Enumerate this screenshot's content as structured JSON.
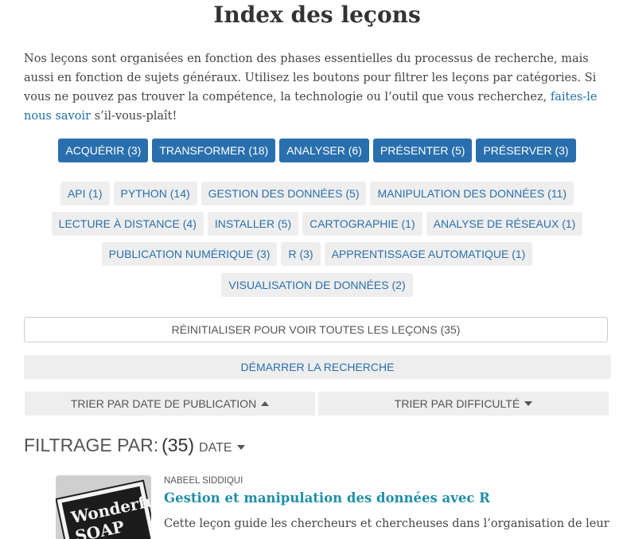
{
  "page": {
    "title": "Index des leçons",
    "intro_text": "Nos leçons sont organisées en fonction des phases essentielles du processus de recherche, mais aussi en fonction de sujets généraux. Utilisez les boutons pour filtrer les leçons par catégories. Si vous ne pouvez pas trouver la compétence, la technologie ou l’outil que vous recherchez, ",
    "intro_link": "faites-le nous savoir",
    "intro_end": " s’il-vous-plaît!"
  },
  "phases": [
    {
      "label": "ACQUÉRIR (3)"
    },
    {
      "label": "TRANSFORMER (18)"
    },
    {
      "label": "ANALYSER (6)"
    },
    {
      "label": "PRÉSENTER (5)"
    },
    {
      "label": "PRÉSERVER (3)"
    }
  ],
  "topics": {
    "row1": [
      {
        "label": "API (1)"
      },
      {
        "label": "PYTHON (14)"
      },
      {
        "label": "GESTION DES DONNÉES (5)"
      },
      {
        "label": "MANIPULATION DES DONNÉES (11)"
      }
    ],
    "row2": [
      {
        "label": "LECTURE À DISTANCE (4)"
      },
      {
        "label": "INSTALLER (5)"
      },
      {
        "label": "CARTOGRAPHIE (1)"
      },
      {
        "label": "ANALYSE DE RÉSEAUX (1)"
      }
    ],
    "row3": [
      {
        "label": "PUBLICATION NUMÉRIQUE (3)"
      },
      {
        "label": "R (3)"
      },
      {
        "label": "APPRENTISSAGE AUTOMATIQUE (1)"
      }
    ],
    "row4": [
      {
        "label": "VISUALISATION DE DONNÉES (2)"
      }
    ]
  },
  "controls": {
    "reset_label": "RÉINITIALISER POUR VOIR TOUTES LES LEÇONS (35)",
    "search_label": "DÉMARRER LA RECHERCHE",
    "sort_date_label": "TRIER PAR DATE DE PUBLICATION",
    "sort_difficulty_label": "TRIER PAR DIFFICULTÉ"
  },
  "filter": {
    "label": "FILTRAGE PAR:",
    "count": "(35)",
    "sort_label": "DATE"
  },
  "lesson": {
    "author": "NABEEL SIDDIQUI",
    "title": "Gestion et manipulation des données avec R",
    "excerpt": "Cette leçon guide les chercheurs et chercheuses dans l’organisation de leurs",
    "thumb_text": "Wonderful SOAP"
  },
  "colors": {
    "phase_bg": "#2a6fad",
    "topic_bg": "#eeeeee",
    "link": "#1e6fa8",
    "lesson_title": "#1e8fa8"
  }
}
